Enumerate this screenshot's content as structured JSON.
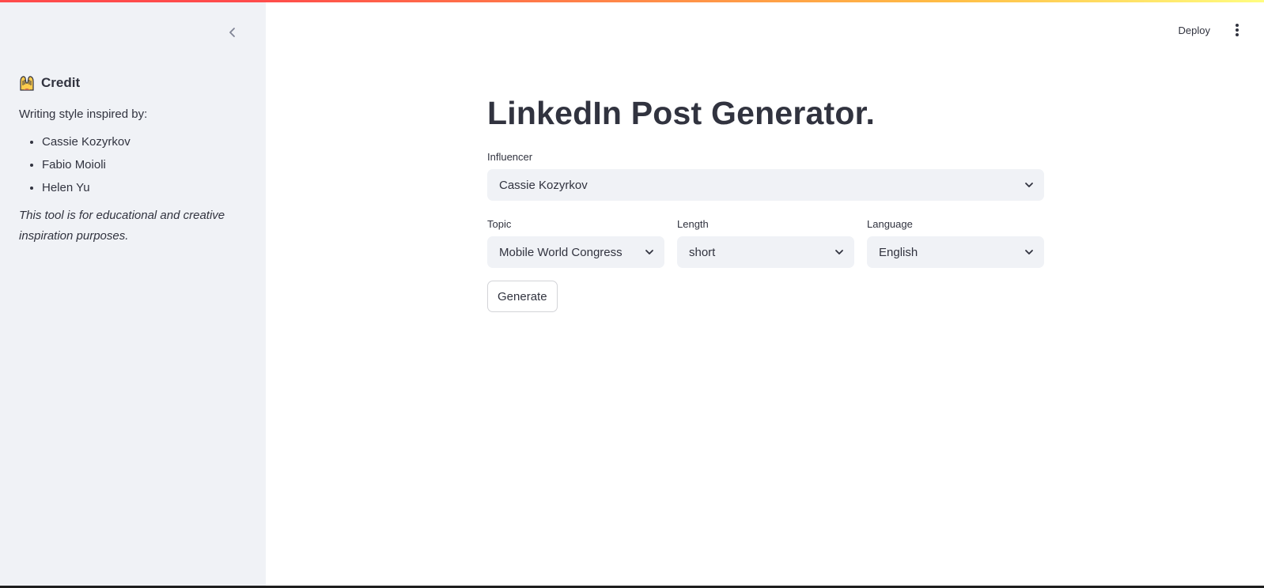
{
  "sidebar": {
    "credit_heading": "Credit",
    "intro": "Writing style inspired by:",
    "influencers": [
      "Cassie Kozyrkov",
      "Fabio Moioli",
      "Helen Yu"
    ],
    "disclaimer": "This tool is for educational and creative inspiration purposes."
  },
  "header": {
    "deploy_label": "Deploy"
  },
  "main": {
    "title": "LinkedIn Post Generator.",
    "influencer": {
      "label": "Influencer",
      "value": "Cassie Kozyrkov"
    },
    "topic": {
      "label": "Topic",
      "value": "Mobile World Congress"
    },
    "length": {
      "label": "Length",
      "value": "short"
    },
    "language": {
      "label": "Language",
      "value": "English"
    },
    "generate_label": "Generate"
  },
  "colors": {
    "sidebar_bg": "#f0f2f6",
    "text": "#31333f",
    "accent": "#ff4b4b"
  }
}
